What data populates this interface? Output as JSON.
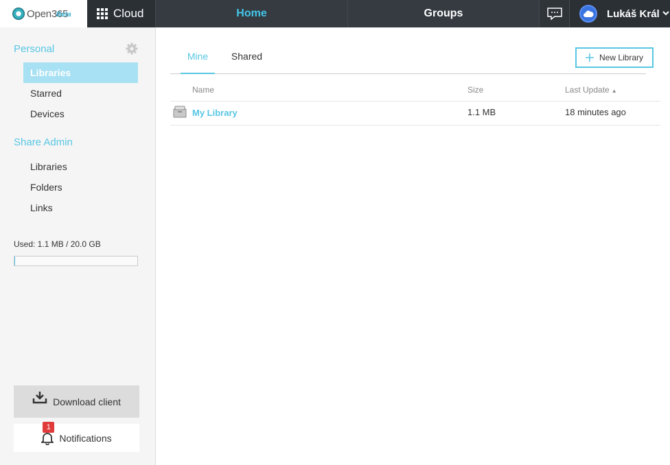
{
  "header": {
    "logo_text": "Open365",
    "logo_beta": "Beta",
    "cloud_label": "Cloud",
    "nav_home": "Home",
    "nav_groups": "Groups",
    "user_name": "Lukáš Král"
  },
  "sidebar": {
    "personal_title": "Personal",
    "personal_items": [
      "Libraries",
      "Starred",
      "Devices"
    ],
    "share_admin_title": "Share Admin",
    "share_admin_items": [
      "Libraries",
      "Folders",
      "Links"
    ],
    "used_text": "Used: 1.1 MB / 20.0 GB",
    "usage_fraction": 0.00055,
    "download_label": "Download client",
    "notifications_label": "Notifications",
    "notifications_count": "1"
  },
  "main": {
    "tabs": [
      "Mine",
      "Shared"
    ],
    "new_library_label": "New Library",
    "columns": {
      "name": "Name",
      "size": "Size",
      "last_update": "Last Update"
    },
    "libraries": [
      {
        "name": "My Library",
        "size": "1.1 MB",
        "last_update": "18 minutes ago"
      }
    ]
  },
  "colors": {
    "accent": "#57c6e3",
    "topbar": "#353b41",
    "badge": "#e03a3a"
  }
}
